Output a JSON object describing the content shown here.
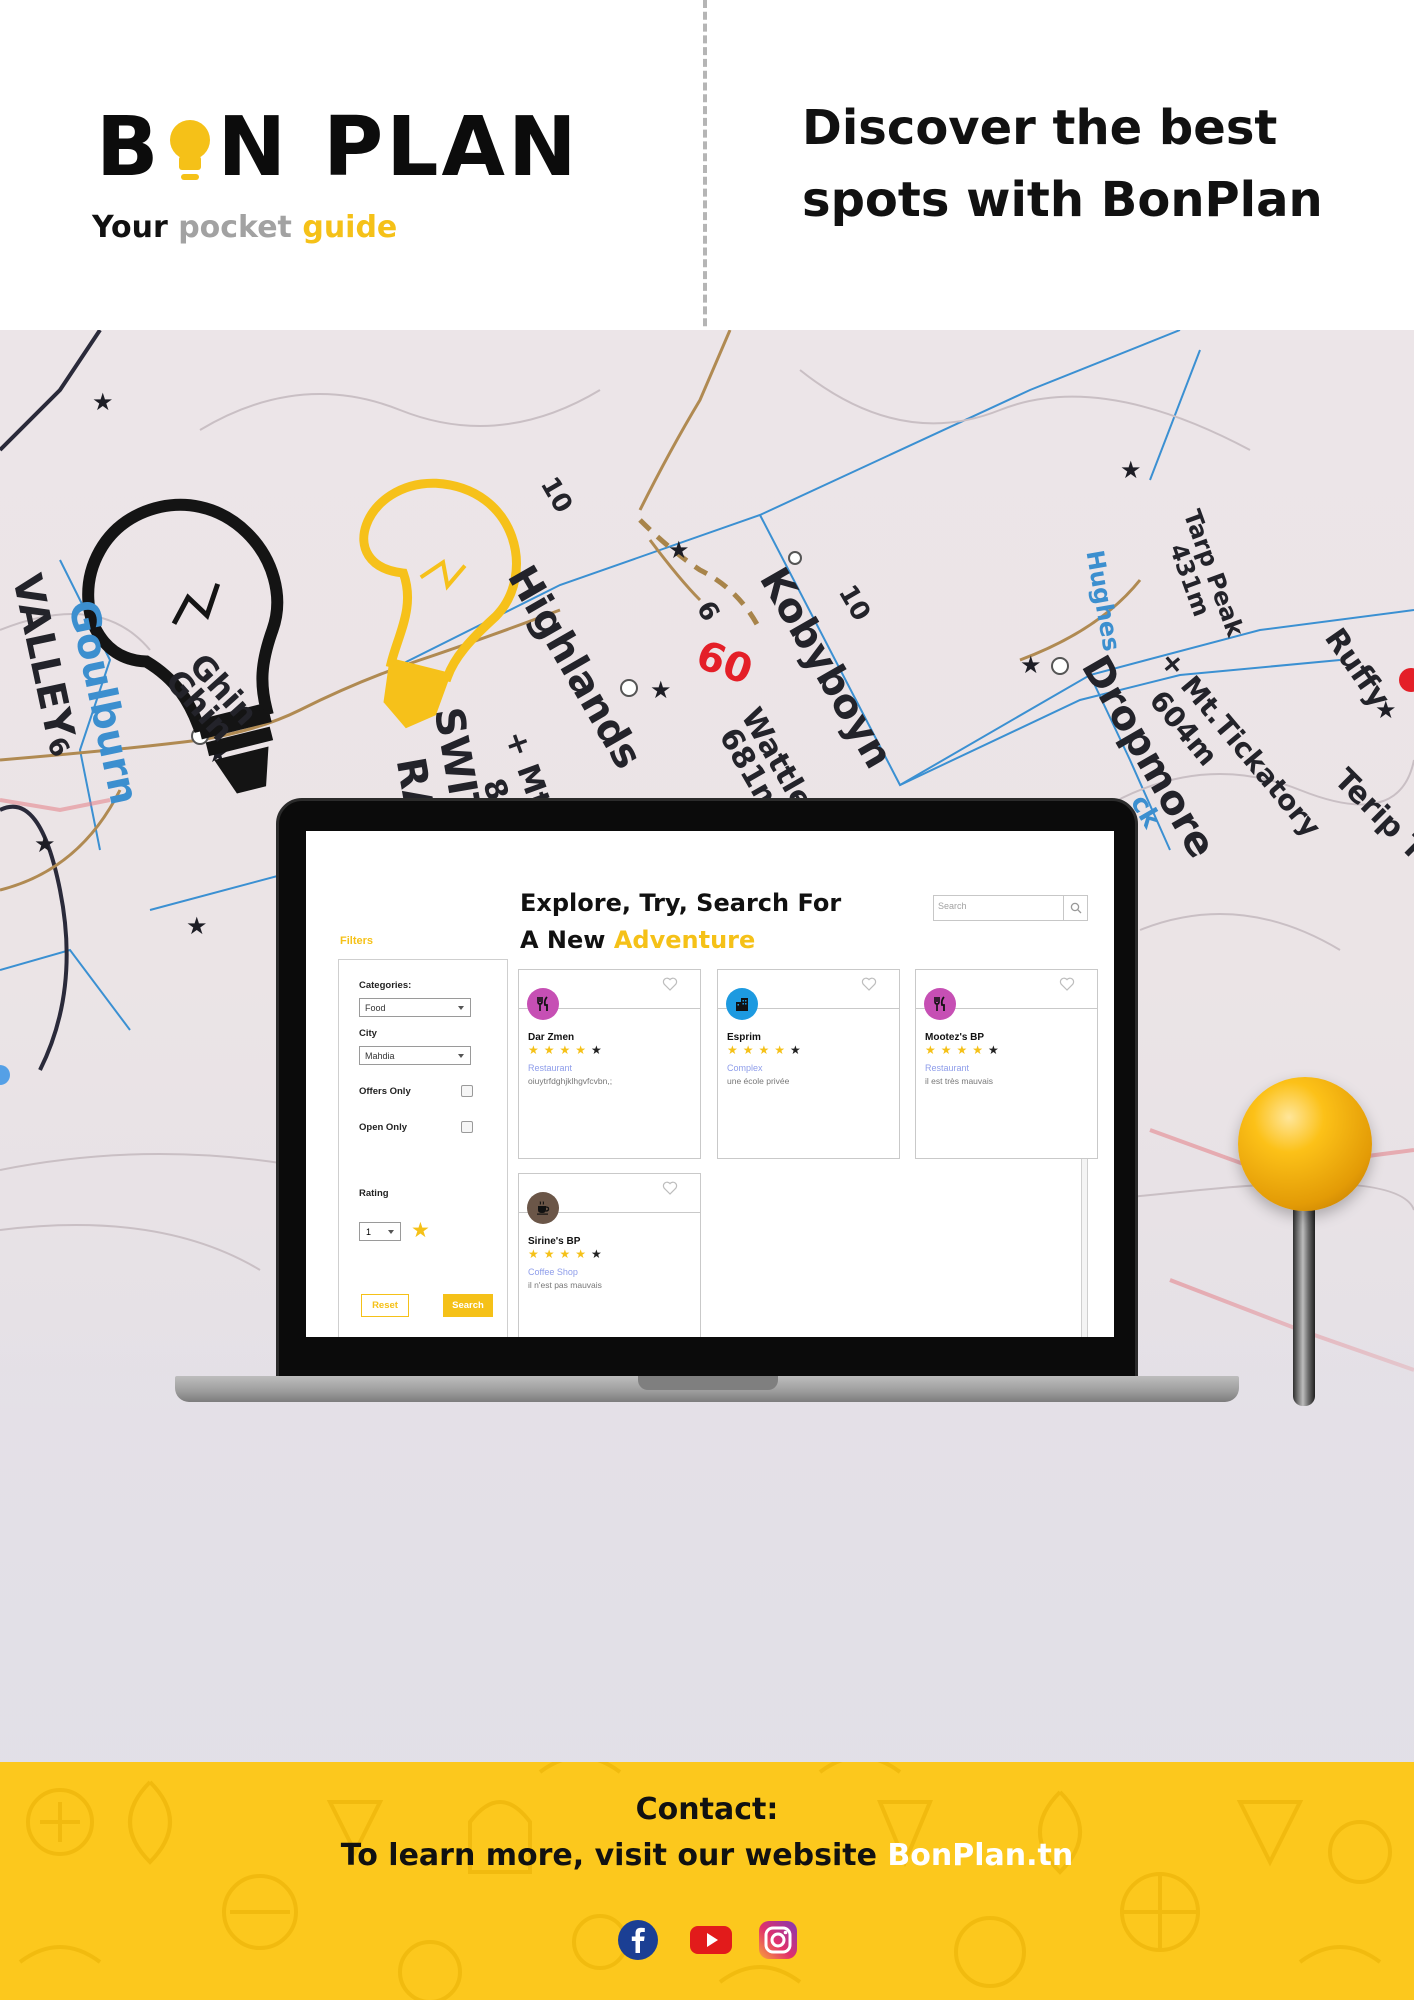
{
  "header": {
    "logo_letters": [
      "B",
      "N",
      "PLAN"
    ],
    "tagline": [
      "Your",
      "pocket",
      "guide"
    ],
    "headline_lines": [
      "Discover the best",
      "spots with BonPlan"
    ]
  },
  "map": {
    "labels": [
      "Highlands",
      "Kobyboyn",
      "10",
      "6",
      "60",
      "Goulburn",
      "VALLEY",
      "Ghin",
      "Ghin",
      "SWITZ",
      "RA",
      "+ Mt.B",
      "81",
      "Wattle Hill",
      "681m",
      "Dropmore",
      "+ Mt.Tickatory",
      "604m",
      "Ruffy",
      "Terip Te",
      "Hughes",
      "Tarp Peak",
      "431m",
      "6",
      "10",
      "ck"
    ]
  },
  "app": {
    "title_line1": "Explore, Try, Search For",
    "title_line2_plain": "A New",
    "title_line2_accent": "Adventure",
    "search_placeholder": "Search",
    "filters": {
      "title": "Filters",
      "categories_label": "Categories:",
      "category_value": "Food",
      "city_label": "City",
      "city_value": "Mahdia",
      "offers_label": "Offers Only",
      "open_label": "Open Only",
      "rating_label": "Rating",
      "rating_value": "1",
      "reset_label": "Reset",
      "search_label": "Search"
    },
    "cards": [
      {
        "name": "Dar Zmen",
        "category": "Restaurant",
        "description": "oiuytrfdghjklhgvfcvbn,;",
        "rating": 4,
        "icon": "fork-knife-icon",
        "icon_color": "#c64fb4"
      },
      {
        "name": "Esprim",
        "category": "Complex",
        "description": "une école privée",
        "rating": 4,
        "icon": "building-icon",
        "icon_color": "#1d9ae0"
      },
      {
        "name": "Mootez's BP",
        "category": "Restaurant",
        "description": "il est très mauvais",
        "rating": 4,
        "icon": "fork-knife-icon",
        "icon_color": "#c64fb4"
      },
      {
        "name": "Sirine's BP",
        "category": "Coffee Shop",
        "description": "il n'est pas mauvais",
        "rating": 4,
        "icon": "coffee-cup-icon",
        "icon_color": "#6b5648"
      }
    ]
  },
  "footer": {
    "contact_title": "Contact:",
    "contact_text": "To learn more, visit our website",
    "website": "BonPlan.tn",
    "social_icons": [
      "facebook-icon",
      "youtube-icon",
      "instagram-icon"
    ]
  },
  "colors": {
    "accent": "#f5c118",
    "footer_bg": "#fcc81d"
  }
}
